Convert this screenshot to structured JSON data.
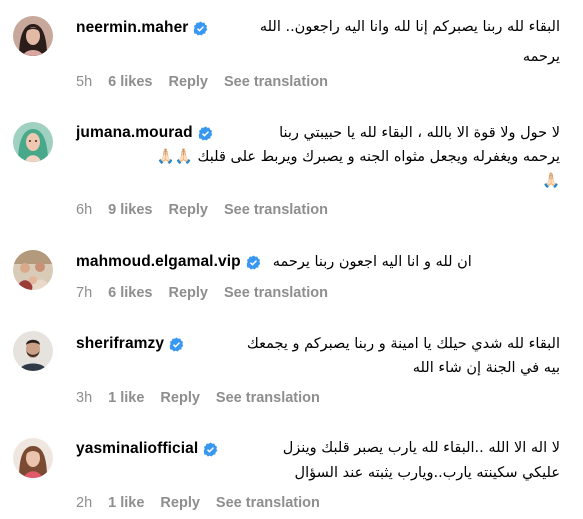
{
  "comments": [
    {
      "username": "neermin.maher",
      "verified": true,
      "lines": [
        "البقاء لله ربنا يصبركم إنا لله وانا اليه راجعون.. الله",
        "يرحمه"
      ],
      "time": "5h",
      "likes": "6 likes",
      "reply": "Reply",
      "translation": "See translation",
      "avatar_icon": "avatar-woman-dark-hair"
    },
    {
      "username": "jumana.mourad",
      "verified": true,
      "lines": [
        "لا حول ولا قوة الا بالله ، البقاء لله يا حبيبتي ربنا",
        "يرحمه ويغفرله ويجعل مثواه الجنه و يصبرك ويربط على قلبك 🙏🏻🙏🏻",
        "🙏🏻"
      ],
      "time": "6h",
      "likes": "9 likes",
      "reply": "Reply",
      "translation": "See translation",
      "avatar_icon": "avatar-woman-green-scarf"
    },
    {
      "username": "mahmoud.elgamal.vip",
      "verified": true,
      "lines": [
        "ان لله و انا اليه اجعون ربنا يرحمه"
      ],
      "time": "7h",
      "likes": "6 likes",
      "reply": "Reply",
      "translation": "See translation",
      "avatar_icon": "avatar-group-photo"
    },
    {
      "username": "sheriframzy",
      "verified": true,
      "lines": [
        "البقاء لله شدي حيلك يا امينة و ربنا يصبركم و يجمعك",
        "بيه في الجنة إن شاء الله"
      ],
      "time": "3h",
      "likes": "1 like",
      "reply": "Reply",
      "translation": "See translation",
      "avatar_icon": "avatar-man-beard"
    },
    {
      "username": "yasminaliofficial",
      "verified": true,
      "lines": [
        "لا اله الا الله ..البقاء لله يارب يصبر قلبك وينزل",
        "عليكي سكينته يارب..ويارب يثبته عند السؤال"
      ],
      "time": "2h",
      "likes": "1 like",
      "reply": "Reply",
      "translation": "See translation",
      "avatar_icon": "avatar-woman-brown-hair"
    }
  ],
  "colors": {
    "meta_gray": "#8e8e8e",
    "verified_blue": "#3897f0",
    "text": "#000000"
  }
}
